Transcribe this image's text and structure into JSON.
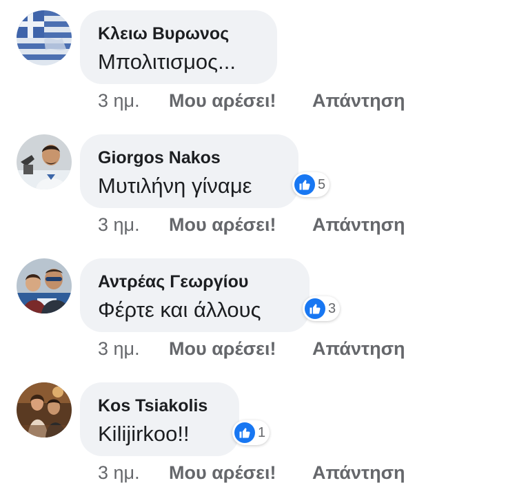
{
  "comments": [
    {
      "author": "Κλειω Βυρωνος",
      "text": "Μπολιτισμος...",
      "time": "3 ημ.",
      "like_label": "Μου αρέσει!",
      "reply_label": "Απάντηση",
      "reaction_count": null,
      "avatar_icon": "greek-flag-avatar"
    },
    {
      "author": "Giorgos Nakos",
      "text": "Μυτιλήνη γίναμε",
      "time": "3 ημ.",
      "like_label": "Μου αρέσει!",
      "reply_label": "Απάντηση",
      "reaction_count": "5",
      "avatar_icon": "person-microscope-avatar"
    },
    {
      "author": "Αντρέας Γεωργίου",
      "text": "Φέρτε και άλλους",
      "time": "3 ημ.",
      "like_label": "Μου αρέσει!",
      "reply_label": "Απάντηση",
      "reaction_count": "3",
      "avatar_icon": "man-with-child-avatar"
    },
    {
      "author": "Kos Tsiakolis",
      "text": "Kilijirkoo!!",
      "time": "3 ημ.",
      "like_label": "Μου αρέσει!",
      "reply_label": "Απάντηση",
      "reaction_count": "1",
      "avatar_icon": "couple-room-avatar"
    }
  ],
  "colors": {
    "bubble": "#f0f2f5",
    "like_blue": "#1877f2",
    "meta_gray": "#65676b"
  }
}
